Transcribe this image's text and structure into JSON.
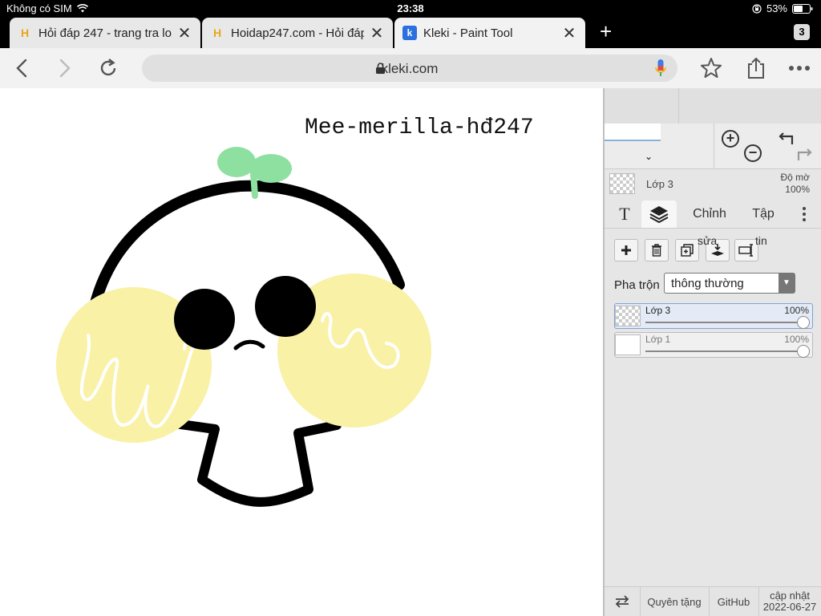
{
  "status_bar": {
    "carrier": "Không có SIM",
    "time": "23:38",
    "battery": "53%"
  },
  "browser": {
    "tabs": [
      {
        "title": "Hỏi đáp 247 - trang tra loi",
        "active": false
      },
      {
        "title": "Hoidap247.com - Hỏi đáp o",
        "active": false
      },
      {
        "title": "Kleki - Paint Tool",
        "active": true
      }
    ],
    "tab_count": "3",
    "url": "kleki.com"
  },
  "canvas": {
    "watermark_text": "Mee-merilla-hđ247"
  },
  "panel": {
    "current_layer": {
      "name": "Lớp 3",
      "opacity_label": "Độ mờ",
      "opacity_value": "100%"
    },
    "tabs": [
      {
        "label": "T",
        "icon": "text-icon"
      },
      {
        "label": "",
        "icon": "layers-icon",
        "active": true
      },
      {
        "label": "Chỉnh"
      },
      {
        "label": "Tập"
      }
    ],
    "tool_labels": {
      "left": "sửa",
      "right": "tin"
    },
    "blend": {
      "label": "Pha trộn",
      "value": "thông thường"
    },
    "layers": [
      {
        "name": "Lớp 3",
        "opacity": "100%",
        "opacity_value": 1.0,
        "selected": true
      },
      {
        "name": "Lớp 1",
        "opacity": "100%",
        "opacity_value": 1.0,
        "selected": false
      }
    ],
    "bottom": {
      "gift_label": "Quyên tặng",
      "github_label": "GitHub",
      "update_label": "cập nhật",
      "update_date": "2022-06-27"
    }
  }
}
